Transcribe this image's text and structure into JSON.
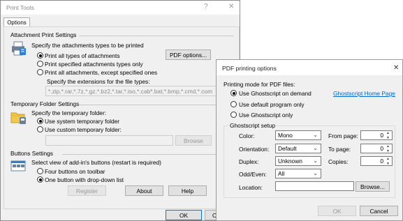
{
  "main": {
    "title": "Print Tools",
    "help_glyph": "?",
    "close_glyph": "✕",
    "tab_options": "Options",
    "attach": {
      "heading": "Attachment Print Settings",
      "prompt": "Specify the attachments types to be printed",
      "opt_all": "Print all types of attachments",
      "opt_specified": "Print specified attachments types only",
      "opt_except": "Print all attachments, except specified ones",
      "ext_prompt": "Specify the extensions for the file types:",
      "ext_value": "*.zip,*.rar,*.7z,*.gz,*.bz2,*.tar,*.iso,*.cab*.bat,*.bmp,*.cmd,*.com",
      "pdf_button": "PDF options..."
    },
    "temp": {
      "heading": "Temporary Folder Settings",
      "prompt": "Specify the temporary folder:",
      "opt_system": "Use system temporary folder",
      "opt_custom": "Use custom temporary folder:",
      "path_value": "",
      "browse": "Browse"
    },
    "buttons": {
      "heading": "Buttons Settings",
      "prompt": "Select view of add-in's buttons (restart is required)",
      "opt_four": "Four buttons on toolbar",
      "opt_one": "One button with drop-down list",
      "register": "Register",
      "about": "About",
      "help": "Help"
    },
    "ok": "OK",
    "cancel": "Ca"
  },
  "pdf": {
    "title": "PDF printing options",
    "close_glyph": "✕",
    "mode_label": "Printing mode for PDF files:",
    "opt_ghostscript_demand": "Use Ghostscript on demand",
    "opt_default_program": "Use default program only",
    "opt_ghostscript_only": "Use Ghostscript only",
    "home_link": "Ghostscript Home Page",
    "setup_title": "Ghostscript setup",
    "color_label": "Color:",
    "color_value": "Mono",
    "orientation_label": "Orientation:",
    "orientation_value": "Default",
    "duplex_label": "Duplex:",
    "duplex_value": "Unknown",
    "oddeven_label": "Odd/Even:",
    "oddeven_value": "All",
    "location_label": "Location:",
    "location_value": "",
    "browse": "Browse...",
    "from_label": "From page:",
    "from_value": "0",
    "to_label": "To page:",
    "to_value": "0",
    "copies_label": "Copies:",
    "copies_value": "0",
    "ok": "OK",
    "cancel": "Cancel"
  },
  "colors": {
    "accent": "#0078d7",
    "link": "#0066cc",
    "window_bg": "#f0f0f0"
  }
}
